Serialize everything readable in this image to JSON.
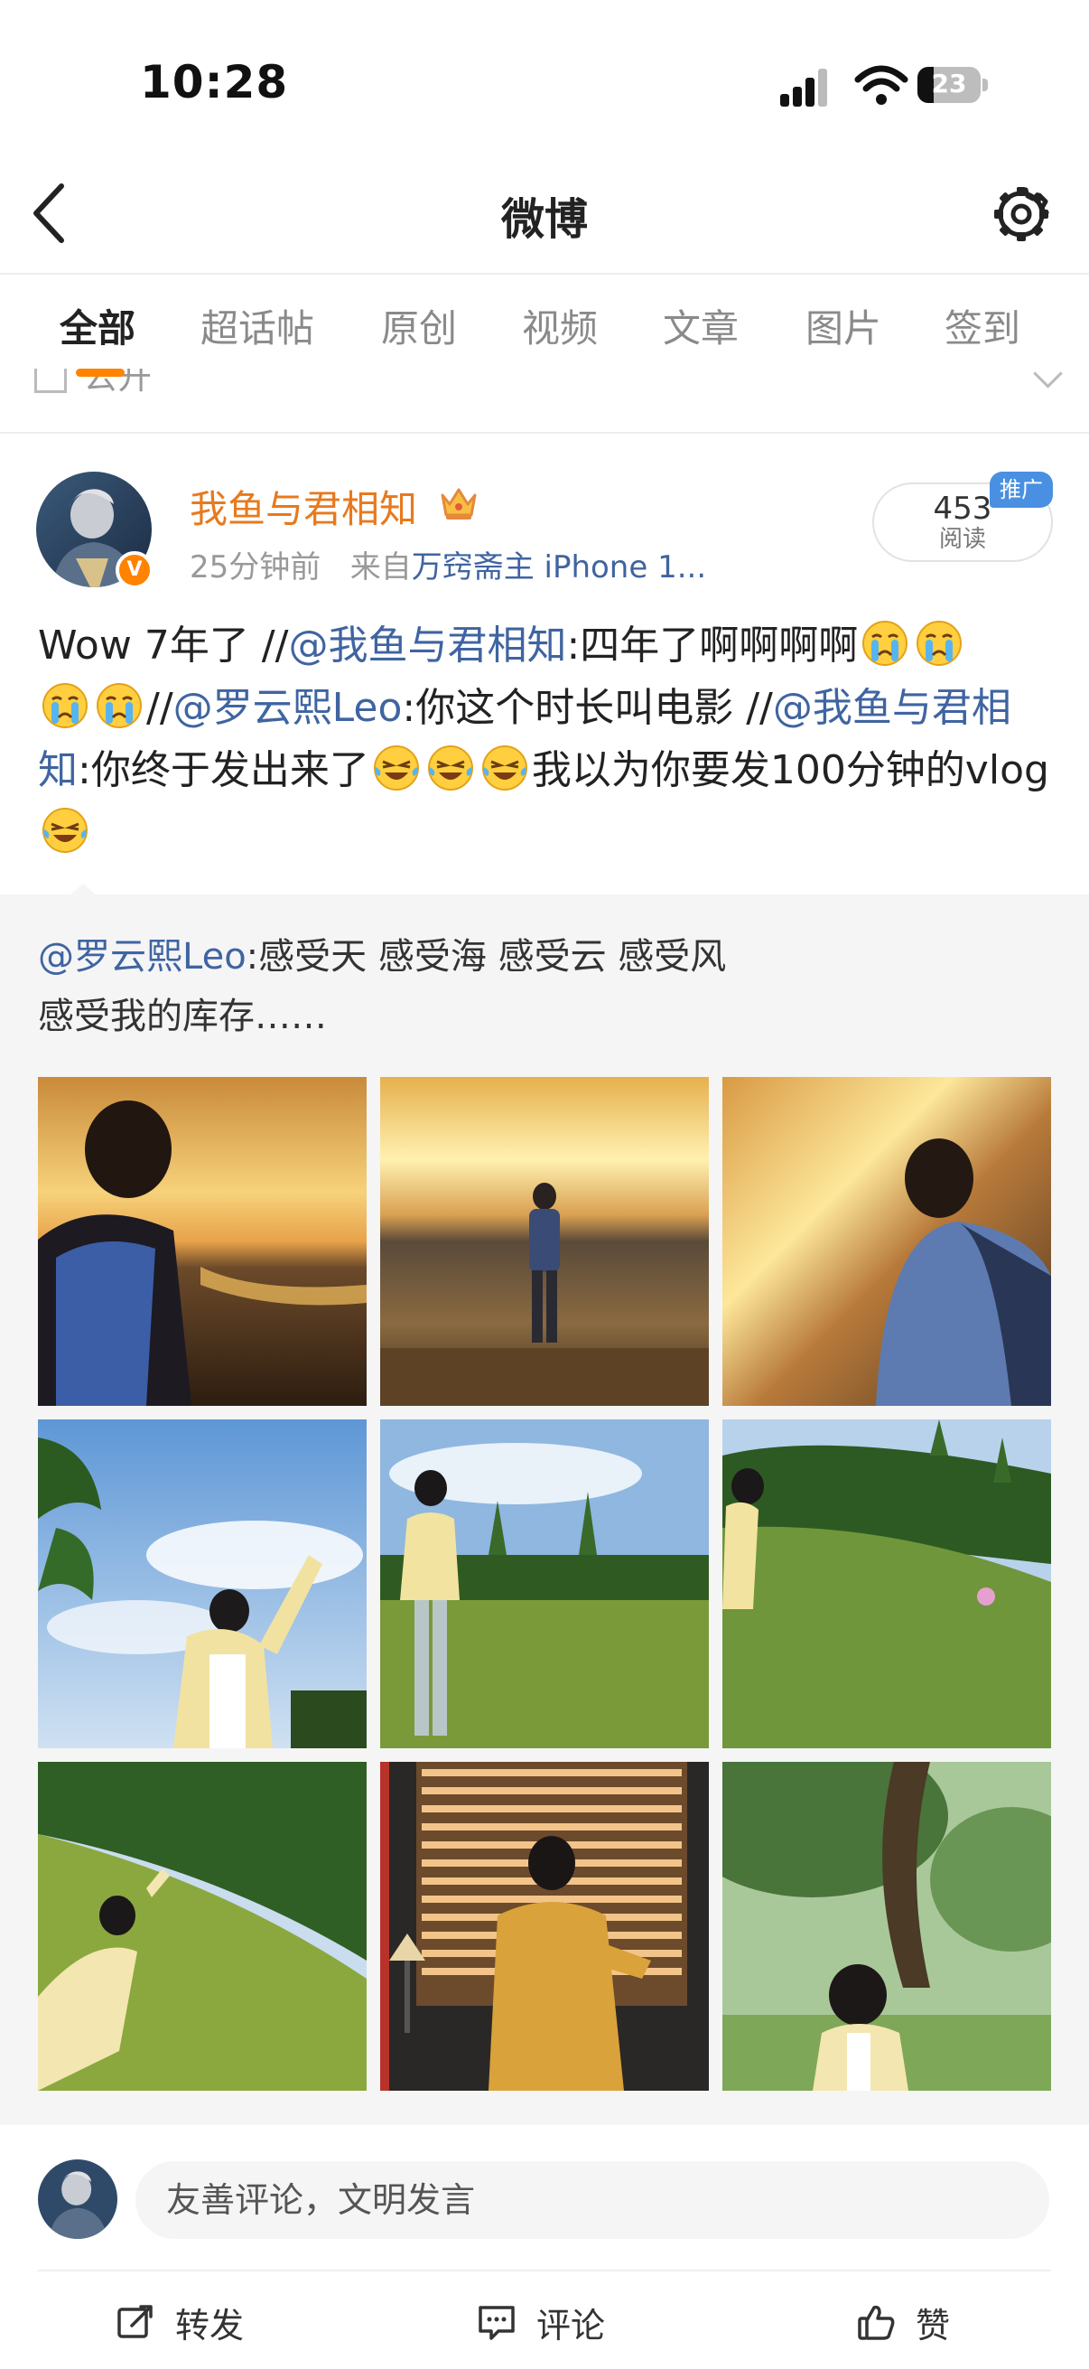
{
  "status_bar": {
    "time": "10:28",
    "battery": "23"
  },
  "nav": {
    "title": "微博"
  },
  "tabs": [
    {
      "label": "全部",
      "active": true
    },
    {
      "label": "超话帖"
    },
    {
      "label": "原创"
    },
    {
      "label": "视频"
    },
    {
      "label": "文章"
    },
    {
      "label": "图片"
    },
    {
      "label": "签到"
    }
  ],
  "behind_row": {
    "text": "公开"
  },
  "post": {
    "username": "我鱼与君相知",
    "time": "25分钟前",
    "source_prefix": "来自",
    "source": "万窍斋主 iPhone 1...",
    "read_count": "453",
    "read_label": "阅读",
    "promo_badge": "推广",
    "content": {
      "t1": "Wow 7年了 //",
      "m1": "@我鱼与君相知",
      "t2": ":四年了啊啊啊啊",
      "t3": "//",
      "m2": "@罗云熙Leo",
      "t4": ":你这个时长叫电影 //",
      "m3": "@我鱼与君相知",
      "t5": ":你终于发出来了",
      "t6": "我以为你要发100分钟的vlog"
    }
  },
  "repost": {
    "mention": "@罗云熙Leo",
    "line1": ":感受天 感受海 感受云 感受风",
    "line2": "感受我的库存……"
  },
  "images": [
    {
      "name": "photo-sunset-silhouette"
    },
    {
      "name": "photo-beach-standing"
    },
    {
      "name": "photo-sunset-back"
    },
    {
      "name": "photo-sky-arm-raised"
    },
    {
      "name": "photo-field-yellow-shirt"
    },
    {
      "name": "photo-hill-grass"
    },
    {
      "name": "photo-hillside-lean"
    },
    {
      "name": "photo-window-blinds"
    },
    {
      "name": "photo-tree-portrait"
    }
  ],
  "comment_bar": {
    "placeholder": "友善评论，文明发言"
  },
  "actions": {
    "repost": "转发",
    "comment": "评论",
    "like": "赞"
  },
  "colors": {
    "accent": "#ff8200",
    "link": "#3f64a1",
    "username": "#e8791d"
  }
}
